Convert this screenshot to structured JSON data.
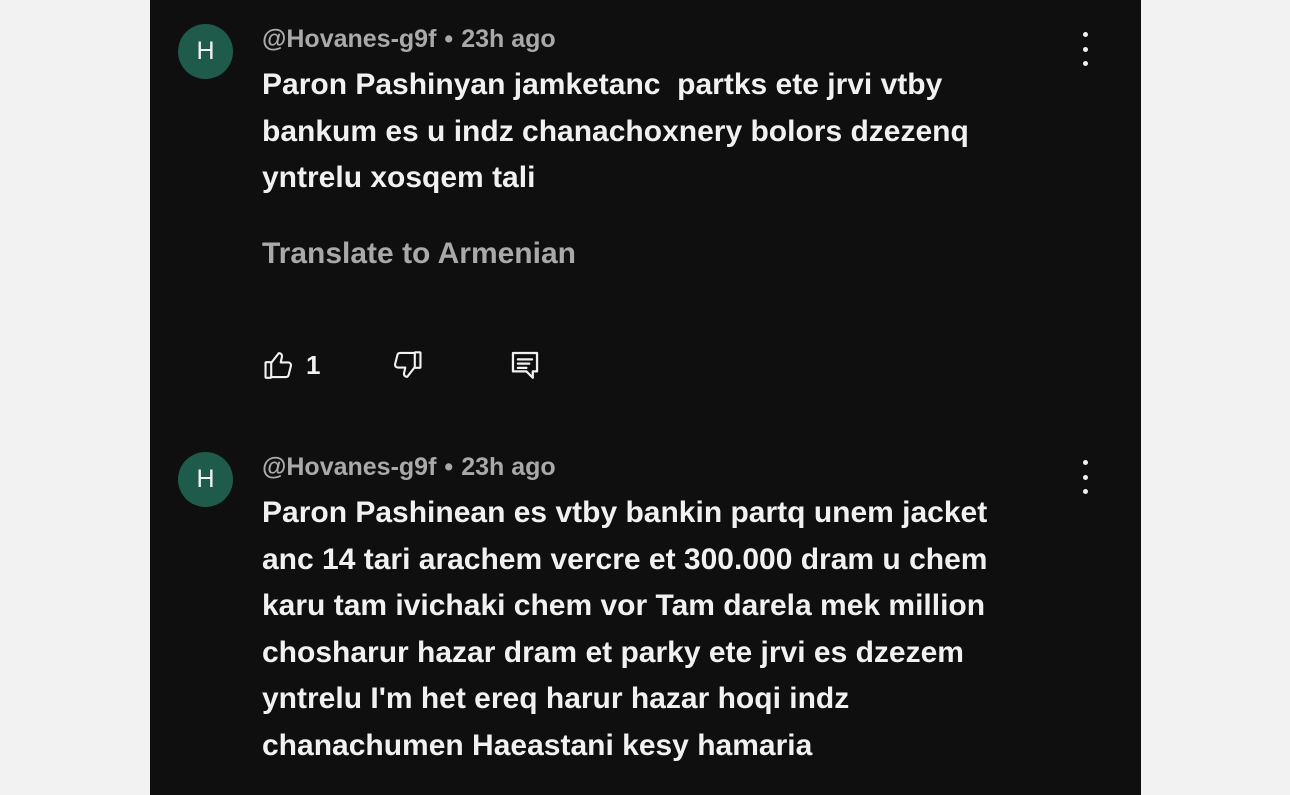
{
  "comments": [
    {
      "avatar_letter": "H",
      "author": "@Hovanes-g9f",
      "separator": "•",
      "time": "23h ago",
      "text": "Paron Pashinyan jamketanc  partks ete jrvi vtby\nbankum es u indz chanachoxnery bolors dzezenq\nyntrelu xosqem tali",
      "translate_label": "Translate to Armenian",
      "like_count": "1",
      "icons": {
        "like": "thumbs-up-icon",
        "dislike": "thumbs-down-icon",
        "reply": "reply-comment-icon",
        "menu": "more-vertical-icon"
      }
    },
    {
      "avatar_letter": "H",
      "author": "@Hovanes-g9f",
      "separator": "•",
      "time": "23h ago",
      "text": "Paron Pashinean es vtby bankin partq unem jacket\nanc 14 tari arachem vercre et 300.000 dram u chem\nkaru tam ivichaki chem vor Tam darela mek million\nchosharur hazar dram et parky ete jrvi es dzezem\nyntrelu I'm het ereq harur hazar hoqi indz\nchanachumen Haeastani kesy hamaria",
      "icons": {
        "menu": "more-vertical-icon"
      }
    }
  ],
  "colors": {
    "background": "#0f0f0f",
    "page_margin": "#f2f2f2",
    "avatar": "#1f5b4b",
    "primary_text": "#f1f1f1",
    "secondary_text": "#a9a9a9"
  }
}
